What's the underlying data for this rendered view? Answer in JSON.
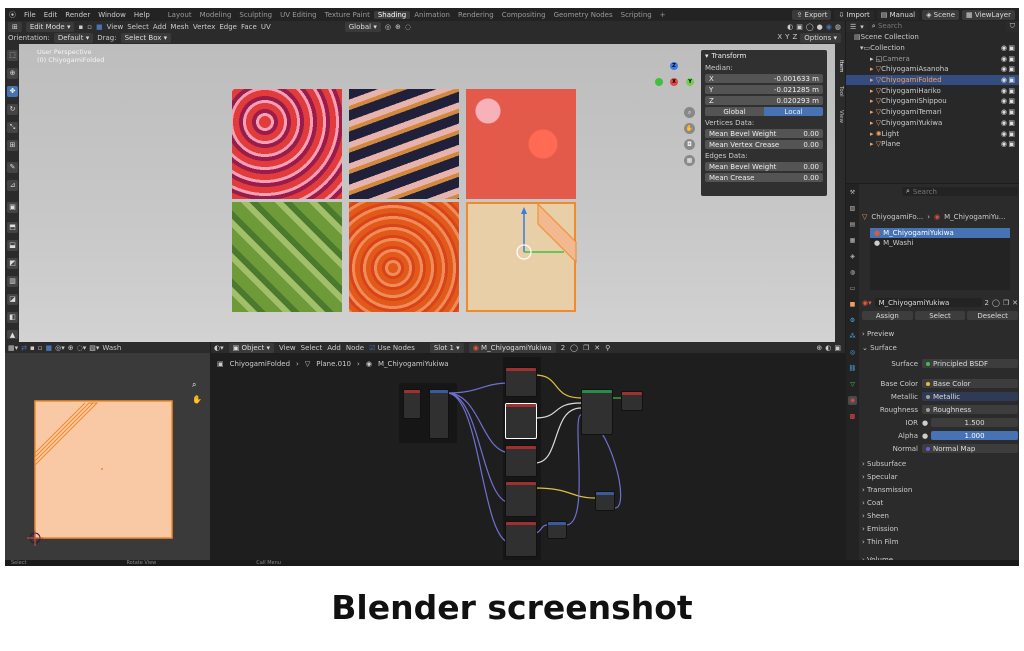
{
  "topbar": {
    "menu": [
      "File",
      "Edit",
      "Render",
      "Window",
      "Help"
    ],
    "workspaces": [
      "Layout",
      "Modeling",
      "Sculpting",
      "UV Editing",
      "Texture Paint",
      "Shading",
      "Animation",
      "Rendering",
      "Compositing",
      "Geometry Nodes",
      "Scripting",
      "+"
    ],
    "active_workspace": "Shading",
    "export": "Export",
    "import": "Import",
    "manual": "Manual",
    "scene": "Scene",
    "view_layer": "ViewLayer"
  },
  "viewport": {
    "mode": "Edit Mode",
    "menus": [
      "View",
      "Select",
      "Add",
      "Mesh",
      "Vertex",
      "Edge",
      "Face",
      "UV"
    ],
    "transform_orientation": "Global",
    "options": "Options",
    "orientation_label": "Orientation:",
    "orientation_value": "Default",
    "drag_label": "Drag:",
    "drag_value": "Select Box",
    "overlay_line1": "User Perspective",
    "overlay_line2": "(0) ChiyogamiFolded",
    "axes": [
      "X",
      "Y",
      "Z"
    ]
  },
  "npanel": {
    "title": "Transform",
    "median": "Median:",
    "x_label": "X",
    "x_value": "-0.001633 m",
    "y_label": "Y",
    "y_value": "-0.021285 m",
    "z_label": "Z",
    "z_value": "0.020293 m",
    "global": "Global",
    "local": "Local",
    "vertices_data": "Vertices Data:",
    "mean_bevel_weight": "Mean Bevel Weight",
    "mbw_value": "0.00",
    "mean_vertex_crease": "Mean Vertex Crease",
    "mvc_value": "0.00",
    "edges_data": "Edges Data:",
    "mean_bevel_weight2": "Mean Bevel Weight",
    "mbw2_value": "0.00",
    "mean_crease": "Mean Crease",
    "mc_value": "0.00",
    "tabs": [
      "Item",
      "Tool",
      "View"
    ]
  },
  "outliner": {
    "search": "Search",
    "scene_collection": "Scene Collection",
    "items": [
      {
        "label": "Collection",
        "color": "#dddddd"
      },
      {
        "label": "Camera",
        "color": "#999999"
      },
      {
        "label": "ChiyogamiAsanoha",
        "color": "#f0a060"
      },
      {
        "label": "ChiyogamiFolded",
        "color": "#f0a060"
      },
      {
        "label": "ChiyogamiHariko",
        "color": "#f0a060"
      },
      {
        "label": "ChiyogamiShippou",
        "color": "#f0a060"
      },
      {
        "label": "ChiyogamiTemari",
        "color": "#f0a060"
      },
      {
        "label": "ChiyogamiYukiwa",
        "color": "#f0a060"
      },
      {
        "label": "Light",
        "color": "#f0a060"
      },
      {
        "label": "Plane",
        "color": "#f0a060"
      }
    ]
  },
  "properties": {
    "search": "Search",
    "breadcrumb_object": "ChiyogamiFo...",
    "breadcrumb_material": "M_ChiyogamiYu...",
    "slots": [
      "M_ChiyogamiYukiwa",
      "M_Washi"
    ],
    "material_name": "M_ChiyogamiYukiwa",
    "user_count": "2",
    "assign": "Assign",
    "select": "Select",
    "deselect": "Deselect",
    "preview": "Preview",
    "surface_section": "Surface",
    "surface_label": "Surface",
    "surface_value": "Principled BSDF",
    "base_color_label": "Base Color",
    "base_color_value": "Base Color",
    "metallic_label": "Metallic",
    "metallic_value": "Metallic",
    "roughness_label": "Roughness",
    "roughness_value": "Roughness",
    "ior_label": "IOR",
    "ior_value": "1.500",
    "alpha_label": "Alpha",
    "alpha_value": "1.000",
    "normal_label": "Normal",
    "normal_value": "Normal Map",
    "sections": [
      "Subsurface",
      "Specular",
      "Transmission",
      "Coat",
      "Sheen",
      "Emission",
      "Thin Film"
    ],
    "volume": "Volume"
  },
  "uv_editor": {
    "mode": "Wash"
  },
  "node_editor": {
    "object_type": "Object",
    "menus": [
      "View",
      "Select",
      "Add",
      "Node"
    ],
    "use_nodes": "Use Nodes",
    "slot": "Slot 1",
    "material": "M_ChiyogamiYukiwa",
    "user_count": "2",
    "breadcrumb": [
      "ChiyogamiFolded",
      "Plane.010",
      "M_ChiyogamiYukiwa"
    ]
  },
  "status": [
    "Select",
    "Rotate View",
    "Call Menu"
  ],
  "caption": "Blender screenshot"
}
